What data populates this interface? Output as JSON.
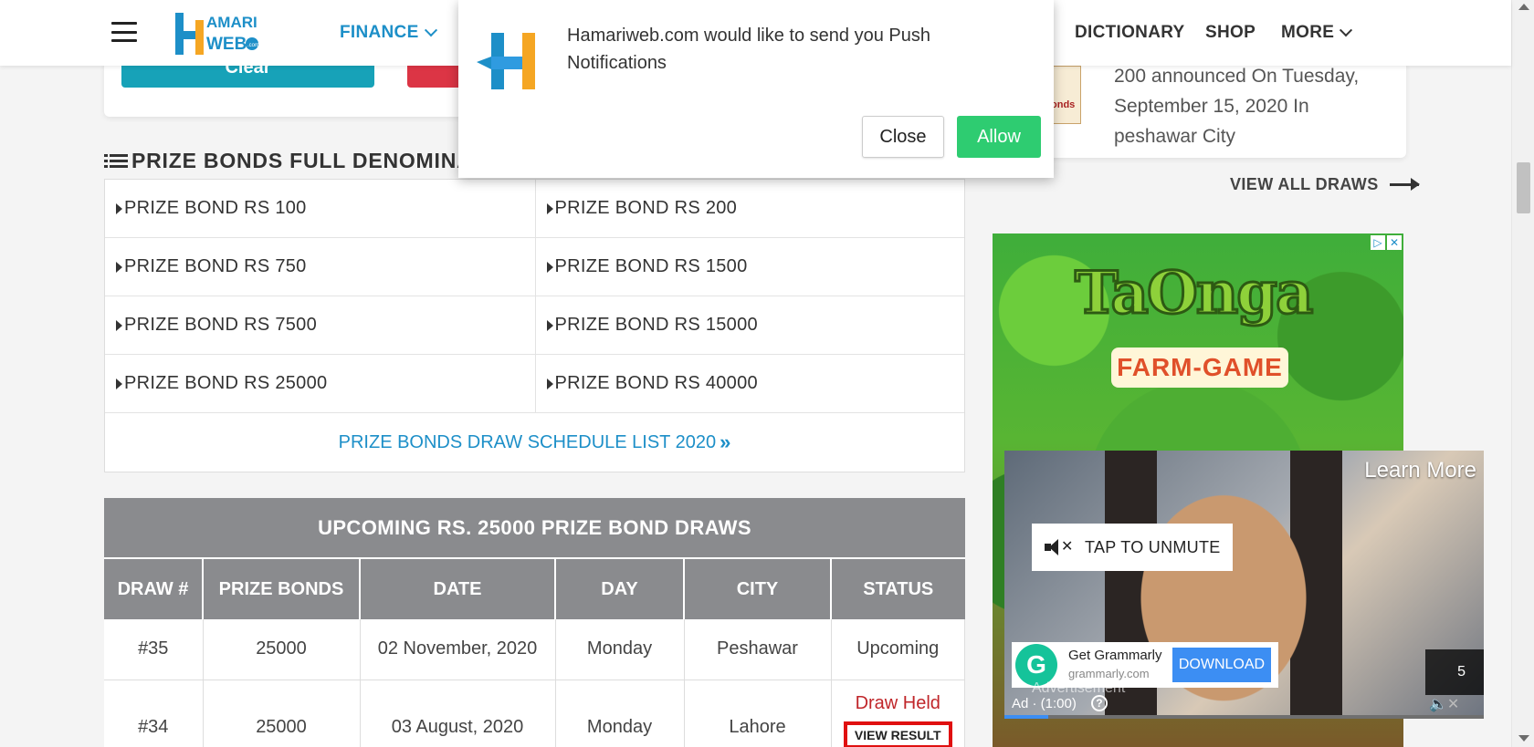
{
  "header": {
    "nav": {
      "finance": "FINANCE",
      "dictionary": "DICTIONARY",
      "shop": "SHOP",
      "more": "MORE"
    },
    "logo_text_top": "AMARI",
    "logo_text_bottom": "WEB",
    "logo_suffix": ".com"
  },
  "push_notification": {
    "message": "Hamariweb.com would like to send you Push Notifications",
    "close_label": "Close",
    "allow_label": "Allow"
  },
  "top_card": {
    "clear_label": "Clear"
  },
  "section": {
    "title": "PRIZE BONDS FULL DENOMINA"
  },
  "denominations": [
    [
      "PRIZE BOND RS 100",
      "PRIZE BOND RS 200"
    ],
    [
      "PRIZE BOND RS 750",
      "PRIZE BOND RS 1500"
    ],
    [
      "PRIZE BOND RS 7500",
      "PRIZE BOND RS 15000"
    ],
    [
      "PRIZE BOND RS 25000",
      "PRIZE BOND RS 40000"
    ]
  ],
  "schedule_link": "PRIZE BONDS DRAW SCHEDULE LIST 2020",
  "draws": {
    "title": "UPCOMING RS. 25000 PRIZE BOND DRAWS",
    "columns": [
      "DRAW #",
      "PRIZE BONDS",
      "DATE",
      "DAY",
      "CITY",
      "STATUS"
    ],
    "rows": [
      {
        "draw": "#35",
        "bond": "25000",
        "date": "02 November, 2020",
        "day": "Monday",
        "city": "Peshawar",
        "status": "Upcoming"
      },
      {
        "draw": "#34",
        "bond": "25000",
        "date": "03 August, 2020",
        "day": "Monday",
        "city": "Lahore",
        "status": "Draw Held",
        "action": "VIEW RESULT"
      }
    ]
  },
  "sidebar": {
    "announcement": "200 announced On Tuesday, September 15, 2020 In peshawar City",
    "thumb_text": "onds",
    "view_all": "VIEW ALL DRAWS"
  },
  "ads": {
    "farm_title": "TaOnga",
    "farm_subtitle": "FARM-GAME",
    "video": {
      "learn_more": "Learn More",
      "unmute": "TAP TO UNMUTE",
      "brand_name": "Get Grammarly",
      "brand_url": "grammarly.com",
      "download": "DOWNLOAD",
      "advertisement": "Advertisement",
      "ad_timer": "Ad · (1:00)",
      "skip_count": "5"
    }
  }
}
